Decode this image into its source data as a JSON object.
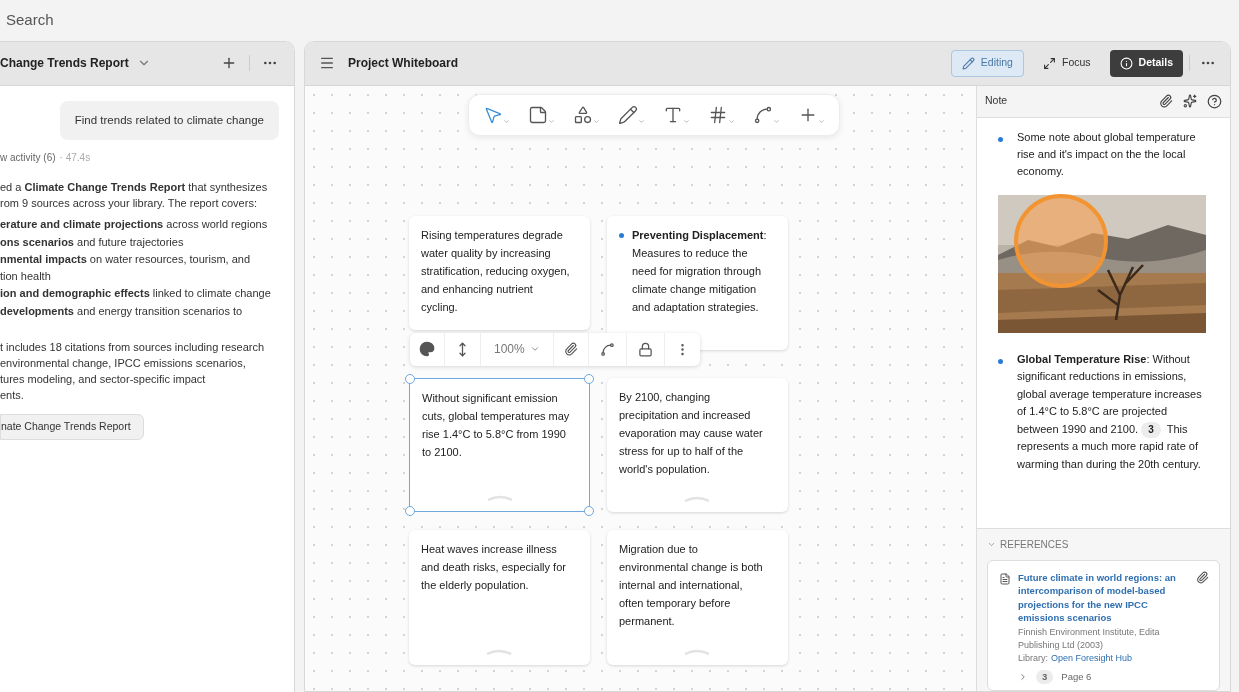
{
  "search": {
    "placeholder": "Search"
  },
  "chat_panel": {
    "title": "Change Trends Report",
    "user_message": "Find trends related to climate change",
    "activity": {
      "label": "w activity (6)",
      "time": "· 47.4s"
    },
    "intro_lines": [
      "ed a **Climate Change Trends Report** that synthesizes",
      "rom 9 sources across your library. The report covers:"
    ],
    "bullet_lines": [
      [
        "**erature and climate projections** across world regions"
      ],
      [
        "**ons scenarios** and future trajectories"
      ],
      [
        "**nmental impacts** on water resources, tourism, and",
        "tion health"
      ],
      [
        "**ion and demographic effects** linked to climate change"
      ],
      [
        "**developments** and energy transition scenarios to"
      ]
    ],
    "summary_lines": [
      "t includes 18 citations from sources including research",
      "environmental change, IPCC emissions scenarios,",
      "tures modeling, and sector-specific impact",
      "ents."
    ],
    "report_button": "nate Change Trends Report"
  },
  "whiteboard": {
    "title": "Project Whiteboard",
    "modes": [
      {
        "label": "Editing",
        "kind": "toggle",
        "selected": true
      },
      {
        "label": "Focus",
        "kind": "toggle",
        "selected": false
      },
      {
        "label": "Details",
        "kind": "panel",
        "selected": true
      }
    ],
    "tools": [
      {
        "selected": true
      },
      {
        "selected": false
      },
      {
        "selected": false
      },
      {
        "selected": false
      },
      {
        "selected": false
      },
      {
        "selected": false
      },
      {
        "selected": false
      },
      {
        "selected": false
      }
    ],
    "card_toolbar": {
      "zoom": "100%"
    },
    "cards": [
      {
        "kind": "plain",
        "text": "Rising temperatures degrade water quality by increasing stratification, reducing oxygen, and enhancing nutrient cycling.",
        "selected": false
      },
      {
        "kind": "bullet",
        "text": "**Preventing Displacement**: Measures to reduce the need for migration through climate change mitigation and adaptation strategies.",
        "selected": false
      },
      {
        "kind": "plain",
        "text": "Without significant emission cuts, global temperatures may rise 1.4°C to 5.8°C from 1990 to 2100.",
        "selected": true
      },
      {
        "kind": "plain",
        "text": "By 2100, changing precipitation and increased evaporation may cause water stress for up to half of the world's population.",
        "selected": false
      },
      {
        "kind": "plain",
        "text": "Heat waves increase illness and death risks, especially for the elderly population.",
        "selected": false
      },
      {
        "kind": "plain",
        "text": "Migration due to environmental change is both internal and international, often temporary before permanent.",
        "selected": false
      }
    ]
  },
  "details": {
    "title": "Note",
    "notes": [
      {
        "kind": "text",
        "text": "Some note about global temperature rise and it's impact on the the local economy."
      },
      {
        "kind": "picture"
      },
      {
        "kind": "cited",
        "text": "**Global Temperature Rise**: Without significant reductions in emissions, global average temperature increases of 1.4°C to 5.8°C are projected between 1990 and 2100.",
        "citation": "3",
        "text_after": "This represents a much more rapid rate of warming than during the 20th century."
      }
    ],
    "references": {
      "heading": "REFERENCES",
      "expanded": true,
      "items": [
        {
          "title": "Future climate in world regions: an intercomparison of model-based projections for the new IPCC emissions scenarios",
          "publisher": "Finnish Environment Institute, Edita Publishing Ltd (2003)",
          "library_label": "Library:",
          "library": "Open Foresight Hub",
          "citation": "3",
          "page": "Page 6",
          "expanded": false
        }
      ]
    }
  }
}
